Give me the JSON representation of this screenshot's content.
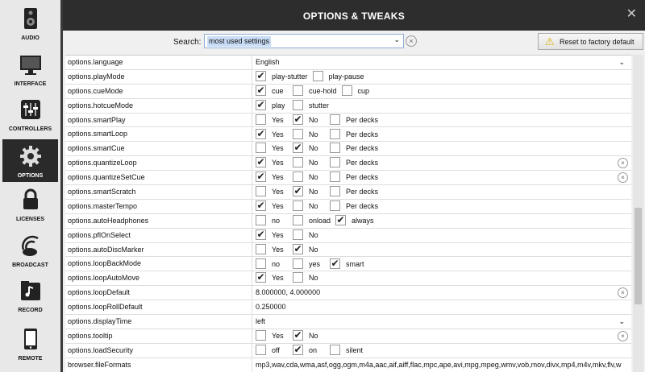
{
  "sidebar": {
    "items": [
      {
        "label": "AUDIO",
        "icon": "speaker-icon",
        "active": false
      },
      {
        "label": "INTERFACE",
        "icon": "monitor-icon",
        "active": false
      },
      {
        "label": "CONTROLLERS",
        "icon": "sliders-icon",
        "active": false
      },
      {
        "label": "OPTIONS",
        "icon": "gear-icon",
        "active": true
      },
      {
        "label": "LICENSES",
        "icon": "lock-icon",
        "active": false
      },
      {
        "label": "BROADCAST",
        "icon": "broadcast-icon",
        "active": false
      },
      {
        "label": "RECORD",
        "icon": "record-folder-icon",
        "active": false
      },
      {
        "label": "REMOTE",
        "icon": "tablet-icon",
        "active": false
      }
    ]
  },
  "dialog": {
    "title": "OPTIONS & TWEAKS",
    "close_glyph": "✕"
  },
  "search": {
    "label": "Search:",
    "value": "most used settings",
    "dropdown_glyph": "⌄",
    "clear_glyph": "×"
  },
  "reset_button": {
    "label": "Reset to factory default",
    "icon": "warning-icon",
    "icon_glyph": "⚠"
  },
  "options": [
    {
      "name": "options.language",
      "type": "dropdown",
      "value": "English"
    },
    {
      "name": "options.playMode",
      "type": "checks",
      "choices": [
        {
          "label": "play-stutter",
          "checked": true
        },
        {
          "label": "play-pause",
          "checked": false
        }
      ]
    },
    {
      "name": "options.cueMode",
      "type": "checks",
      "choices": [
        {
          "label": "cue",
          "checked": true
        },
        {
          "label": "cue-hold",
          "checked": false
        },
        {
          "label": "cup",
          "checked": false
        }
      ]
    },
    {
      "name": "options.hotcueMode",
      "type": "checks",
      "choices": [
        {
          "label": "play",
          "checked": true
        },
        {
          "label": "stutter",
          "checked": false
        }
      ]
    },
    {
      "name": "options.smartPlay",
      "type": "checks",
      "choices": [
        {
          "label": "Yes",
          "checked": false
        },
        {
          "label": "No",
          "checked": true
        },
        {
          "label": "Per decks",
          "checked": false
        }
      ]
    },
    {
      "name": "options.smartLoop",
      "type": "checks",
      "choices": [
        {
          "label": "Yes",
          "checked": true
        },
        {
          "label": "No",
          "checked": false
        },
        {
          "label": "Per decks",
          "checked": false
        }
      ]
    },
    {
      "name": "options.smartCue",
      "type": "checks",
      "choices": [
        {
          "label": "Yes",
          "checked": false
        },
        {
          "label": "No",
          "checked": true
        },
        {
          "label": "Per decks",
          "checked": false
        }
      ]
    },
    {
      "name": "options.quantizeLoop",
      "type": "checks",
      "clear": true,
      "choices": [
        {
          "label": "Yes",
          "checked": true
        },
        {
          "label": "No",
          "checked": false
        },
        {
          "label": "Per decks",
          "checked": false
        }
      ]
    },
    {
      "name": "options.quantizeSetCue",
      "type": "checks",
      "clear": true,
      "choices": [
        {
          "label": "Yes",
          "checked": true
        },
        {
          "label": "No",
          "checked": false
        },
        {
          "label": "Per decks",
          "checked": false
        }
      ]
    },
    {
      "name": "options.smartScratch",
      "type": "checks",
      "choices": [
        {
          "label": "Yes",
          "checked": false
        },
        {
          "label": "No",
          "checked": true
        },
        {
          "label": "Per decks",
          "checked": false
        }
      ]
    },
    {
      "name": "options.masterTempo",
      "type": "checks",
      "choices": [
        {
          "label": "Yes",
          "checked": true
        },
        {
          "label": "No",
          "checked": false
        },
        {
          "label": "Per decks",
          "checked": false
        }
      ]
    },
    {
      "name": "options.autoHeadphones",
      "type": "checks",
      "choices": [
        {
          "label": "no",
          "checked": false
        },
        {
          "label": "onload",
          "checked": false
        },
        {
          "label": "always",
          "checked": true
        }
      ]
    },
    {
      "name": "options.pflOnSelect",
      "type": "checks",
      "choices": [
        {
          "label": "Yes",
          "checked": true
        },
        {
          "label": "No",
          "checked": false
        }
      ]
    },
    {
      "name": "options.autoDiscMarker",
      "type": "checks",
      "choices": [
        {
          "label": "Yes",
          "checked": false
        },
        {
          "label": "No",
          "checked": true
        }
      ]
    },
    {
      "name": "options.loopBackMode",
      "type": "checks",
      "choices": [
        {
          "label": "no",
          "checked": false
        },
        {
          "label": "yes",
          "checked": false
        },
        {
          "label": "smart",
          "checked": true
        }
      ]
    },
    {
      "name": "options.loopAutoMove",
      "type": "checks",
      "choices": [
        {
          "label": "Yes",
          "checked": true
        },
        {
          "label": "No",
          "checked": false
        }
      ]
    },
    {
      "name": "options.loopDefault",
      "type": "text",
      "value": "8.000000, 4.000000",
      "clear": true
    },
    {
      "name": "options.loopRollDefault",
      "type": "text",
      "value": "0.250000"
    },
    {
      "name": "options.displayTime",
      "type": "dropdown",
      "value": "left"
    },
    {
      "name": "options.tooltip",
      "type": "checks",
      "clear": true,
      "choices": [
        {
          "label": "Yes",
          "checked": false
        },
        {
          "label": "No",
          "checked": true
        }
      ]
    },
    {
      "name": "options.loadSecurity",
      "type": "checks",
      "choices": [
        {
          "label": "off",
          "checked": false
        },
        {
          "label": "on",
          "checked": true
        },
        {
          "label": "silent",
          "checked": false
        }
      ]
    },
    {
      "name": "browser.fileFormats",
      "type": "text",
      "value": "mp3,wav,cda,wma,asf,ogg,ogm,m4a,aac,aif,aiff,flac,mpc,ape,avi,mpg,mpeg,wmv,vob,mov,divx,mp4,m4v,mkv,flv,w"
    }
  ]
}
